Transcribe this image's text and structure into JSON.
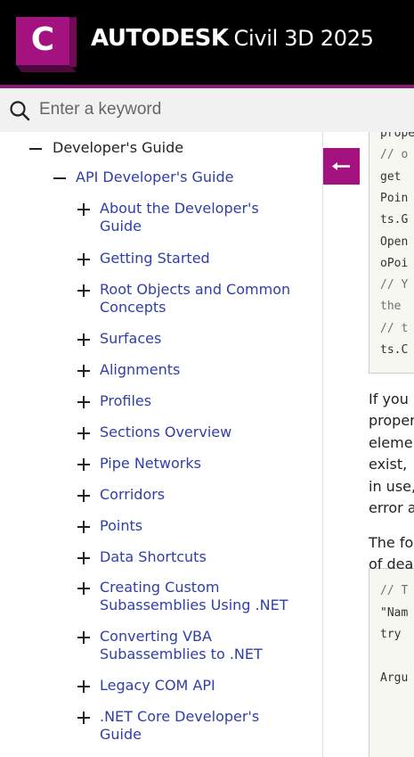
{
  "header": {
    "logo_letter": "C",
    "brand_bold": "AUTODESK",
    "brand_product": "Civil 3D 2025",
    "accent_color": "#8a1a75",
    "logo_color": "#a3127f"
  },
  "search": {
    "placeholder": "Enter a keyword",
    "value": "",
    "icon": "search-icon"
  },
  "toc": {
    "root": {
      "label": "Developer's Guide",
      "toggle": "collapse"
    },
    "child": {
      "label": "API Developer's Guide",
      "toggle": "collapse"
    },
    "items": [
      {
        "label": "About the Developer's Guide",
        "lines": [
          "About the Developer's",
          "Guide"
        ]
      },
      {
        "label": "Getting Started",
        "lines": [
          "Getting Started"
        ]
      },
      {
        "label": "Root Objects and Common Concepts",
        "lines": [
          "Root Objects and Common",
          "Concepts"
        ]
      },
      {
        "label": "Surfaces",
        "lines": [
          "Surfaces"
        ]
      },
      {
        "label": "Alignments",
        "lines": [
          "Alignments"
        ]
      },
      {
        "label": "Profiles",
        "lines": [
          "Profiles"
        ]
      },
      {
        "label": "Sections Overview",
        "lines": [
          "Sections Overview"
        ]
      },
      {
        "label": "Pipe Networks",
        "lines": [
          "Pipe Networks"
        ]
      },
      {
        "label": "Corridors",
        "lines": [
          "Corridors"
        ]
      },
      {
        "label": "Points",
        "lines": [
          "Points"
        ]
      },
      {
        "label": "Data Shortcuts",
        "lines": [
          "Data Shortcuts"
        ]
      },
      {
        "label": "Creating Custom Subassemblies Using .NET",
        "lines": [
          "Creating Custom",
          "Subassemblies Using .NET"
        ]
      },
      {
        "label": "Converting VBA Subassemblies to .NET",
        "lines": [
          "Converting VBA",
          "Subassemblies to .NET"
        ]
      },
      {
        "label": "Legacy COM API",
        "lines": [
          "Legacy COM API"
        ]
      },
      {
        "label": ".NET Core Developer's Guide",
        "lines": [
          ".NET Core Developer's",
          "Guide"
        ]
      }
    ],
    "link_color": "#2f3fa8"
  },
  "back_button": {
    "icon": "arrow-left-icon",
    "color": "#a3127f"
  },
  "content": {
    "code_block_1": [
      {
        "text": "prope",
        "comment": false
      },
      {
        "text": "// o",
        "comment": true
      },
      {
        "text": "get",
        "comment": false
      },
      {
        "text": "Poin",
        "comment": false
      },
      {
        "text": "ts.G",
        "comment": false
      },
      {
        "text": "Open",
        "comment": false
      },
      {
        "text": "oPoi",
        "comment": false
      },
      {
        "text": "// Y",
        "comment": true
      },
      {
        "text": "the",
        "comment": true
      },
      {
        "text": "// t",
        "comment": true
      },
      {
        "text": "ts.C",
        "comment": false
      }
    ],
    "paragraph_1": [
      "If you",
      "proper",
      "eleme",
      "exist,",
      "in use,",
      "error a"
    ],
    "paragraph_2": [
      "The fo",
      "of dea"
    ],
    "code_block_2": [
      {
        "text": "// T",
        "comment": true
      },
      {
        "text": "\"Nam",
        "comment": false
      },
      {
        "text": "try",
        "comment": false
      },
      {
        "text": "",
        "comment": false
      },
      {
        "text": "Argu",
        "comment": false
      }
    ]
  }
}
